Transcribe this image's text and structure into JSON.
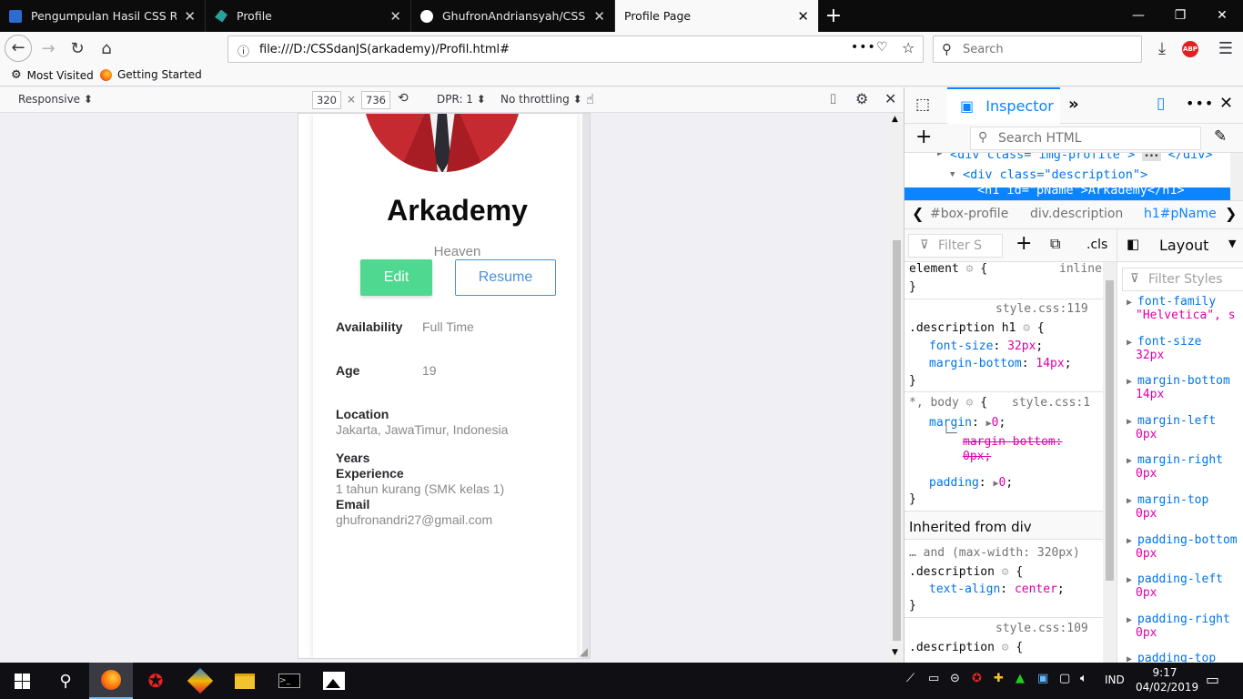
{
  "tabs": [
    {
      "title": "Pengumpulan Hasil CSS Respo",
      "favicon_color": "#2e6bd1"
    },
    {
      "title": "Profile",
      "favicon_color": "#2aa198"
    },
    {
      "title": "GhufronAndriansyah/CSSrespo",
      "favicon_color": "#ffffff"
    },
    {
      "title": "Profile Page",
      "favicon_color": "#f9f9fa"
    }
  ],
  "window": {
    "minimize": "—",
    "restore": "❐",
    "close": "✕",
    "new_tab": "+"
  },
  "nav": {
    "url": "file:///D:/CSSdanJS(arkademy)/Profil.html#",
    "search_placeholder": "Search",
    "abp_label": "ABP"
  },
  "bookmarks": [
    {
      "label": "Most Visited"
    },
    {
      "label": "Getting Started"
    }
  ],
  "rdm": {
    "device": "Responsive ⬍",
    "width": "320",
    "times": "×",
    "height": "736",
    "dpr": "DPR: 1 ⬍",
    "throttling": "No throttling ⬍"
  },
  "profile": {
    "name": "Arkademy",
    "job": "Heaven",
    "edit_label": "Edit",
    "resume_label": "Resume",
    "details": [
      {
        "label": "Availability",
        "value": "Full Time"
      },
      {
        "label": "Age",
        "value": "19"
      },
      {
        "label": "Location",
        "value": "Jakarta, JawaTimur, Indonesia"
      },
      {
        "label": "Years",
        "label2": "Experience",
        "value": "1 tahun kurang (SMK kelas 1)"
      },
      {
        "label": "Email",
        "value": "ghufronandri27@gmail.com"
      }
    ]
  },
  "devtools": {
    "inspector_label": "Inspector",
    "search_html_placeholder": "Search HTML",
    "markup": [
      "<div class=\"img-profile\">",
      "<div class=\"description\">",
      "<h1 id=\"pName\">Arkademy</h1>"
    ],
    "markup_ellipsis": "•••",
    "markup_end_tag": "</div>",
    "breadcrumbs": [
      "#box-profile",
      "div.description",
      "h1#pName"
    ],
    "filter_styles_placeholder": "Filter S",
    "cls_label": ".cls",
    "layout_label": "Layout",
    "computed_filter_placeholder": "Filter Styles",
    "rules": {
      "element_selector": "element",
      "element_source": "inline",
      "rule1_source": "style.css:119",
      "rule1_selector": ".description h1",
      "rule1_p1": "font-size",
      "rule1_v1": "32px",
      "rule1_p2": "margin-bottom",
      "rule1_v2": "14px",
      "rule2_selector": "*, body",
      "rule2_source": "style.css:1",
      "rule2_p1": "margin",
      "rule2_v1": "0",
      "rule2_sub_p": "margin-bottom:",
      "rule2_sub_v": "0px",
      "rule2_p2": "padding",
      "rule2_v2": "0",
      "inherited_header": "Inherited from div",
      "media_query": "… and (max-width: 320px)",
      "rule3_selector": ".description",
      "rule3_p1": "text-align",
      "rule3_v1": "center",
      "rule4_source": "style.css:109",
      "rule4_selector": ".description"
    },
    "computed": [
      {
        "prop": "font-family",
        "value": "\"Helvetica\", s"
      },
      {
        "prop": "font-size",
        "value": "32px"
      },
      {
        "prop": "margin-bottom",
        "value": "14px"
      },
      {
        "prop": "margin-left",
        "value": "0px"
      },
      {
        "prop": "margin-right",
        "value": "0px"
      },
      {
        "prop": "margin-top",
        "value": "0px"
      },
      {
        "prop": "padding-bottom",
        "value": "0px"
      },
      {
        "prop": "padding-left",
        "value": "0px"
      },
      {
        "prop": "padding-right",
        "value": "0px"
      },
      {
        "prop": "padding-top",
        "value": ""
      }
    ]
  },
  "taskbar": {
    "time": "9:17",
    "date": "04/02/2019",
    "lang": "IND"
  },
  "colors": {
    "accent": "#0a84ff",
    "edit_button": "#4fd88f",
    "resume_border": "#4a90d9",
    "avatar_bg": "#c0202a"
  }
}
